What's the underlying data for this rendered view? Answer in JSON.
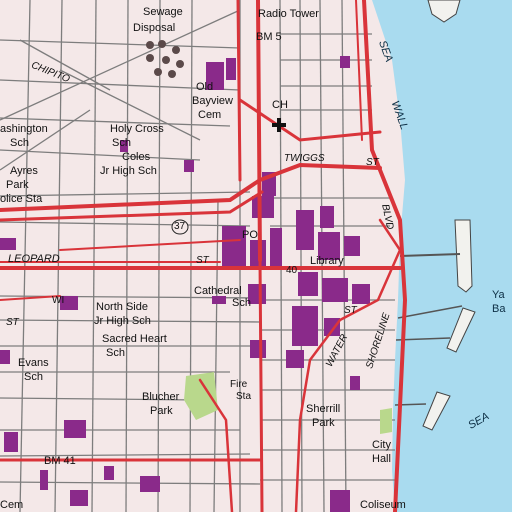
{
  "labels": {
    "sewage": "Sewage",
    "disposal": "Disposal",
    "radio_tower": "Radio Tower",
    "bm5": "BM 5",
    "chipito": "CHIPITO",
    "old": "Old",
    "bayview": "Bayview",
    "cem": "Cem",
    "washington": "ashington",
    "sch1": "Sch",
    "holy_cross": "Holy Cross",
    "sch2": "Sch",
    "ch": "CH",
    "coles": "Coles",
    "jr_high_sch": "Jr High Sch",
    "ayres": "Ayres",
    "park1": "Park",
    "police_sta": "olice Sta",
    "twiggs": "TWIGGS",
    "st_twiggs": "ST",
    "route37": "37",
    "po": "PO",
    "leopard": "LEOPARD",
    "st_leopard": "ST",
    "route40": "40",
    "library": "Library",
    "sea": "SEA",
    "wall": "WALL",
    "blvd": "BLVD",
    "st_left": "ST",
    "wi": "WI",
    "cathedral": "Cathedral",
    "sch_cath": "Sch",
    "north_side": "North Side",
    "jr_high_sch2": "Jr High Sch",
    "sacred_heart": "Sacred Heart",
    "sch3": "Sch",
    "evans": "Evans",
    "sch4": "Sch",
    "water_st": "WATER",
    "shoreline": "SHORELINE",
    "st_water": "ST",
    "fire": "Fire",
    "sta": "Sta",
    "blucher": "Blucher",
    "park2": "Park",
    "sherrill": "Sherrill",
    "park3": "Park",
    "city": "City",
    "hall": "Hall",
    "sea2": "SEA",
    "bm41": "BM 41",
    "cem2": "Cem",
    "coliseum": "Coliseum",
    "ya": "Ya",
    "ba": "Ba"
  },
  "colors": {
    "urban_tint": "#f4e8e8",
    "water": "#a9dbef",
    "road_red": "#d9343a",
    "building": "#8a2a8a",
    "park_green": "#b9d88c",
    "grid_gray": "#7d7d7d"
  }
}
